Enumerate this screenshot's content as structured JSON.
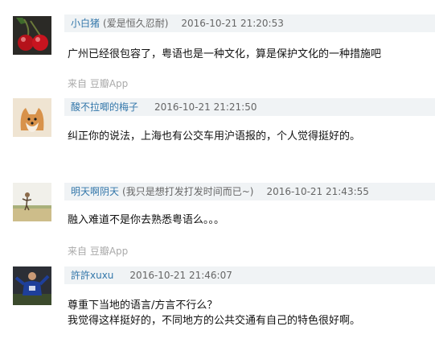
{
  "comments": [
    {
      "author": "小白猪",
      "signature": "(爱是恒久忍耐)",
      "time": "2016-10-21 21:20:53",
      "lines": [
        "广州已经很包容了，粤语也是一种文化，算是保护文化的一种措施吧"
      ],
      "source": "来自 豆瓣App",
      "avatar_icon": "cherries-avatar"
    },
    {
      "author": "酸不拉唧的梅子",
      "signature": "",
      "time": "2016-10-21 21:21:50",
      "lines": [
        "纠正你的说法，上海也有公交车用沪语报的，个人觉得挺好的。"
      ],
      "source": "",
      "avatar_icon": "shiba-dog-avatar"
    },
    {
      "author": "明天啊阴天",
      "signature": "(我只是想打发打发时间而已~)",
      "time": "2016-10-21 21:43:55",
      "lines": [
        "融入难道不是你去熟悉粤语么。。。"
      ],
      "source": "来自 豆瓣App",
      "avatar_icon": "landscape-person-avatar"
    },
    {
      "author": "許許xuxu",
      "signature": "",
      "time": "2016-10-21 21:46:07",
      "lines": [
        "尊重下当地的语言/方言不行么？",
        "我觉得这样挺好的，不同地方的公共交通有自己的特色很好啊。"
      ],
      "source": "",
      "avatar_icon": "soccer-player-avatar"
    }
  ]
}
